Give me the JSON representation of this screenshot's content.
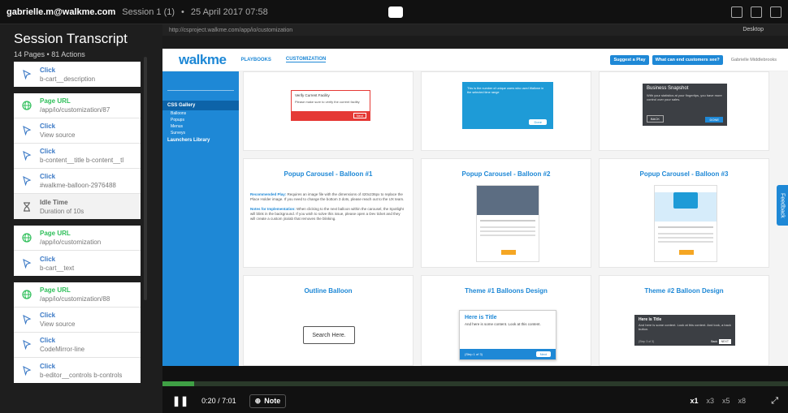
{
  "topbar": {
    "user": "gabrielle.m@walkme.com",
    "session": "Session 1 (1)",
    "sep": "•",
    "datetime": "25 April 2017 07:58"
  },
  "sidebar": {
    "title": "Session Transcript",
    "pages": "14 Pages",
    "bullet": "•",
    "actions": "81 Actions",
    "groups": [
      {
        "items": [
          {
            "type": "click",
            "label": "Click",
            "value": "b-cart__description"
          }
        ]
      },
      {
        "items": [
          {
            "type": "url",
            "label": "Page URL",
            "value": "/app/io/customization/87"
          },
          {
            "type": "click",
            "label": "Click",
            "value": "View source"
          },
          {
            "type": "click",
            "label": "Click",
            "value": "b-content__title b-content__tl"
          },
          {
            "type": "click",
            "label": "Click",
            "value": "#walkme-balloon-2976488"
          },
          {
            "type": "idle",
            "label": "Idle Time",
            "value": "Duration of 10s"
          }
        ]
      },
      {
        "items": [
          {
            "type": "url",
            "label": "Page URL",
            "value": "/app/io/customization"
          },
          {
            "type": "click",
            "label": "Click",
            "value": "b-cart__text"
          }
        ]
      },
      {
        "items": [
          {
            "type": "url",
            "label": "Page URL",
            "value": "/app/io/customization/88"
          },
          {
            "type": "click",
            "label": "Click",
            "value": "View source"
          },
          {
            "type": "click",
            "label": "Click",
            "value": "CodeMirror-line"
          },
          {
            "type": "click",
            "label": "Click",
            "value": "b-editor__controls b-controls"
          }
        ]
      }
    ]
  },
  "browser": {
    "url": "http://csproject.walkme.com/app/io/customization",
    "device": "Desktop"
  },
  "site": {
    "logo": "walkme",
    "nav": [
      "PLAYBOOKS",
      "CUSTOMIZATION"
    ],
    "btn_suggest": "Suggest a Play",
    "btn_customers": "What can end customers see?",
    "user": "Gabrielle Middlebrooks",
    "left_menu": {
      "active": "CSS Gallery",
      "items": [
        "Balloons",
        "Popups",
        "Menus",
        "Surveys"
      ],
      "library": "Launchers Library"
    },
    "cards": [
      {
        "title": "",
        "popup_title": "Verify Current Facility",
        "popup_text": "Please make sure to verify the current facility",
        "popup_btn": "Next"
      },
      {
        "title": "",
        "popup_text": "This is the number of unique users who used Walkme in the selected time range",
        "popup_btn": "Done"
      },
      {
        "title": "",
        "popup_title": "Business Snapshot",
        "popup_text": "With your statistics at your fingertips, you have more control over your sales.",
        "popup_back": "BACK",
        "popup_done": "DONE"
      },
      {
        "title": "Popup Carousel - Balloon #1",
        "rec_label": "Recommended Play:",
        "rec_text": "Requires an image file with the dimensions of 420x236px to replace the Place Holder image. If you need to change the bottom 3 dots, please reach out to the UX team.",
        "notes_label": "Notes for Implementation:",
        "notes_text": "When clicking to the next balloon within the carousel, the Spotlight will blink in the background. If you wish to solve this issue, please open a Dev ticket and they will create a custom jira/ab that removes the blinking."
      },
      {
        "title": "Popup Carousel - Balloon #2"
      },
      {
        "title": "Popup Carousel - Balloon #3"
      },
      {
        "title": "Outline Balloon",
        "balloon_text": "Search Here."
      },
      {
        "title": "Theme #1 Balloons Design",
        "b_title": "Here is Title",
        "b_text": "And here is some content. Look at this content.",
        "b_step": "(Step 1 of 3)",
        "b_btn": "Next"
      },
      {
        "title": "Theme #2 Balloon Design",
        "b_title": "Here is Title",
        "b_text": "And here is some content. Look at this content. And look, a back button.",
        "b_step": "(Step 3 of 3)",
        "b_back": "Back",
        "b_next": "NEXT"
      }
    ],
    "feedback": "Feedback"
  },
  "player": {
    "time": "0:20 / 7:01",
    "note": "Note",
    "speeds": [
      "x1",
      "x3",
      "x5",
      "x8"
    ],
    "progress": 0.05
  }
}
